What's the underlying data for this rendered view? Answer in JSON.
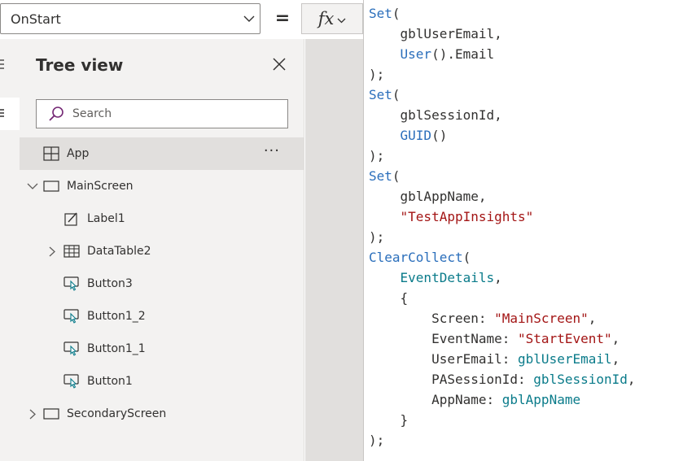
{
  "formula_bar": {
    "property": "OnStart",
    "equals": "=",
    "fx_label": "fx"
  },
  "tree_view": {
    "title": "Tree view",
    "search_placeholder": "Search",
    "more_label": "···",
    "items": [
      {
        "label": "App",
        "icon": "app-icon"
      },
      {
        "label": "MainScreen",
        "icon": "screen-icon"
      },
      {
        "label": "Label1",
        "icon": "label-icon"
      },
      {
        "label": "DataTable2",
        "icon": "table-icon"
      },
      {
        "label": "Button3",
        "icon": "button-icon"
      },
      {
        "label": "Button1_2",
        "icon": "button-icon"
      },
      {
        "label": "Button1_1",
        "icon": "button-icon"
      },
      {
        "label": "Button1",
        "icon": "button-icon"
      },
      {
        "label": "SecondaryScreen",
        "icon": "screen-icon"
      }
    ]
  },
  "code": {
    "tokens": [
      {
        "fn": "Set",
        "p": "("
      },
      {
        "i": "    ",
        "p": "gblUserEmail,"
      },
      {
        "i": "    ",
        "fn": "User",
        "p": "().Email"
      },
      {
        "p": ");"
      },
      {
        "fn": "Set",
        "p": "("
      },
      {
        "i": "    ",
        "p": "gblSessionId,"
      },
      {
        "i": "    ",
        "fn": "GUID",
        "p": "()"
      },
      {
        "p": ");"
      },
      {
        "fn": "Set",
        "p": "("
      },
      {
        "i": "    ",
        "p": "gblAppName,"
      },
      {
        "i": "    ",
        "str": "\"TestAppInsights\""
      },
      {
        "p": ");"
      },
      {
        "fn": "ClearCollect",
        "p": "("
      },
      {
        "i": "    ",
        "id": "EventDetails",
        "p": ","
      },
      {
        "i": "    ",
        "p": "{"
      },
      {
        "i": "        ",
        "p": "Screen: ",
        "str": "\"MainScreen\"",
        "p2": ","
      },
      {
        "i": "        ",
        "p": "EventName: ",
        "str": "\"StartEvent\"",
        "p2": ","
      },
      {
        "i": "        ",
        "p": "UserEmail: ",
        "id": "gblUserEmail",
        "p2": ","
      },
      {
        "i": "        ",
        "p": "PASessionId: ",
        "id": "gblSessionId",
        "p2": ","
      },
      {
        "i": "        ",
        "p": "AppName: ",
        "id": "gblAppName"
      },
      {
        "i": "    ",
        "p": "}"
      },
      {
        "p": ");"
      }
    ]
  },
  "colors": {
    "function": "#2a6ebb",
    "string": "#a31515",
    "identifier": "#0a7b8a",
    "accent": "#742774"
  }
}
